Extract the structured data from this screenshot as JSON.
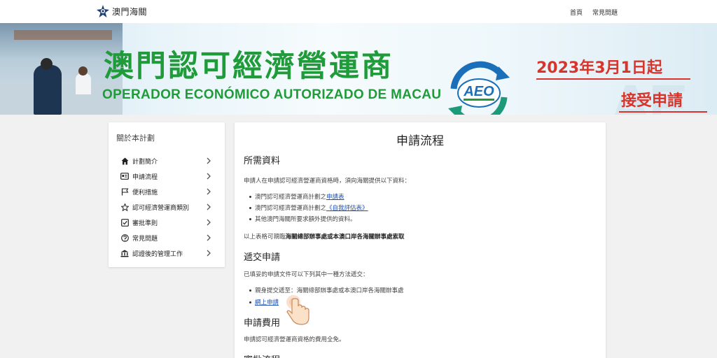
{
  "header": {
    "logo_text": "澳門海關",
    "nav": [
      "首頁",
      "常見問題"
    ]
  },
  "banner": {
    "title_zh": "澳門認可經濟營運商",
    "title_pt": "OPERADOR ECONÓMICO AUTORIZADO DE MACAU",
    "aeo_label": "AEO",
    "date_text": "2023年3月1日起",
    "accept_text": "接受申請",
    "watermark": "AE",
    "colors": {
      "green": "#1f9b3a",
      "red": "#d8342b",
      "blue": "#1b6fb8"
    }
  },
  "sidebar": {
    "title": "關於本計劃",
    "items": [
      {
        "label": "計劃簡介",
        "icon": "home-icon"
      },
      {
        "label": "申請流程",
        "icon": "id-card-icon"
      },
      {
        "label": "便利措施",
        "icon": "flag-icon"
      },
      {
        "label": "認可經濟營運商類別",
        "icon": "star-icon"
      },
      {
        "label": "審批準則",
        "icon": "checkbox-icon"
      },
      {
        "label": "常見問題",
        "icon": "question-icon"
      },
      {
        "label": "認證後的管理工作",
        "icon": "bank-icon"
      }
    ]
  },
  "main": {
    "title": "申請流程",
    "required": {
      "heading": "所需資料",
      "intro": "申請人在申請認可經濟營運商資格時，須向海關提供以下資料：",
      "b1_prefix": "澳門認可經濟營運商計劃之",
      "b1_link": "申請表",
      "b2_prefix": "澳門認可經濟營運商計劃之",
      "b2_link": "《自我評估表》",
      "b3": "其他澳門海關所要求額外提供的資料。",
      "note_prefix": "以上表格可親臨",
      "note_bold": "海關總部辦事處或本澳口岸各海關辦事處索取"
    },
    "submit": {
      "heading": "遞交申請",
      "intro": "已填妥的申請文件可以下列其中一種方法遞交：",
      "b1": "親身提交遞至：海關總部辦事處或本澳口岸各海關辦事處",
      "b2_link": "網上申請"
    },
    "fee": {
      "heading": "申請費用",
      "text": "申請認可經濟營運商資格的費用全免。"
    },
    "next_heading": "審批流程"
  }
}
